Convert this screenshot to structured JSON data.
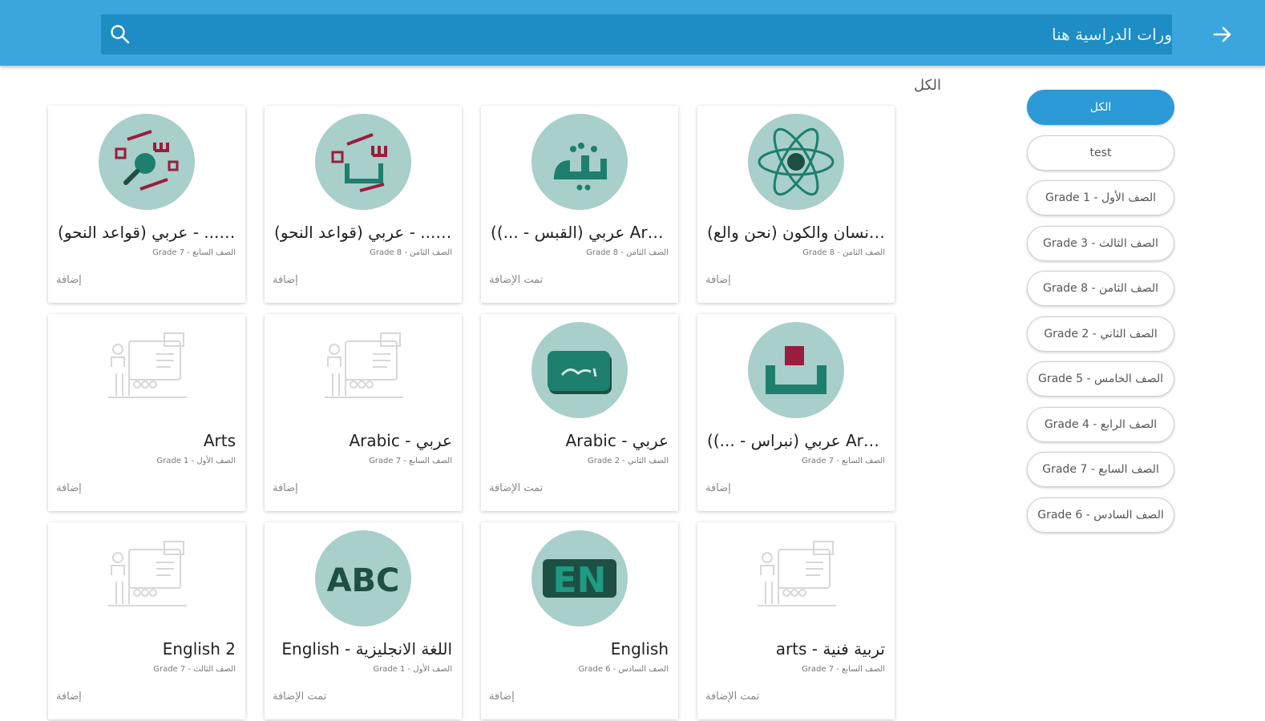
{
  "search": {
    "placeholder": "ورات الدراسية هنا"
  },
  "filters": {
    "heading": "الكل",
    "pills": [
      {
        "label": "الكل",
        "active": true
      },
      {
        "label": "test"
      },
      {
        "label": "Grade 1 - الصف الأول"
      },
      {
        "label": "Grade 3 - الصف الثالث"
      },
      {
        "label": "Grade 8 - الصف الثامن"
      },
      {
        "label": "Grade 2 - الصف الثاني"
      },
      {
        "label": "Grade 5 - الصف الخامس"
      },
      {
        "label": "Grade 4 - الصف الرابع"
      },
      {
        "label": "Grade 7 - الصف السابع"
      },
      {
        "label": "Grade 6 - الصف السادس"
      }
    ]
  },
  "courses": [
    {
      "title": "(الإنسان والكون (نحن والع...",
      "grade": "Grade 8 - الصف الثامن",
      "action": "إضافة",
      "icon": "atom-icon"
    },
    {
      "title": "(عربي (القبس - ...) Arabic",
      "grade": "Grade 8 - الصف الثامن",
      "action": "تمت الإضافة",
      "icon": "qabas-icon"
    },
    {
      "title": "(عربي (قواعد النحو - ...Ara",
      "grade": "Grade 8 - الصف الثامن",
      "action": "إضافة",
      "icon": "grammar-icon"
    },
    {
      "title": "(عربي (قواعد النحو - ...Ara",
      "grade": "Grade 7 - الصف السابع",
      "action": "إضافة",
      "icon": "grammar-search-icon"
    },
    {
      "title": "(عربي (نبراس - ...) Arabic",
      "grade": "Grade 7 - الصف السابع",
      "action": "إضافة",
      "icon": "book-tray-icon"
    },
    {
      "title": "Arabic - عربي",
      "grade": "Grade 2 - الصف الثاني",
      "action": "تمت الإضافة",
      "icon": "arabic-board-icon"
    },
    {
      "title": "Arabic - عربي",
      "grade": "Grade 7 - الصف السابع",
      "action": "إضافة",
      "icon": "classroom-placeholder-icon"
    },
    {
      "title": "Arts",
      "grade": "Grade 1 - الصف الأول",
      "action": "إضافة",
      "icon": "classroom-placeholder-icon"
    },
    {
      "title": "arts - تربية فنية",
      "grade": "Grade 7 - الصف السابع",
      "action": "تمت الإضافة",
      "icon": "classroom-placeholder-icon"
    },
    {
      "title": "English",
      "grade": "Grade 6 - الصف السادس",
      "action": "إضافة",
      "icon": "en-icon"
    },
    {
      "title": "English - اللغة الانجليزية",
      "grade": "Grade 1 - الصف الأول",
      "action": "تمت الإضافة",
      "icon": "abc-icon"
    },
    {
      "title": "English 2",
      "grade": "Grade 7 - الصف الثالث",
      "action": "إضافة",
      "icon": "classroom-placeholder-icon"
    }
  ],
  "colors": {
    "topbar": "#3aa6dd",
    "search_bg": "#1e8cc5",
    "active_pill": "#2c9ad6",
    "icon_circle": "#a8cfc9",
    "icon_dark": "#1e7f6e",
    "icon_accent": "#9b1c3c"
  }
}
